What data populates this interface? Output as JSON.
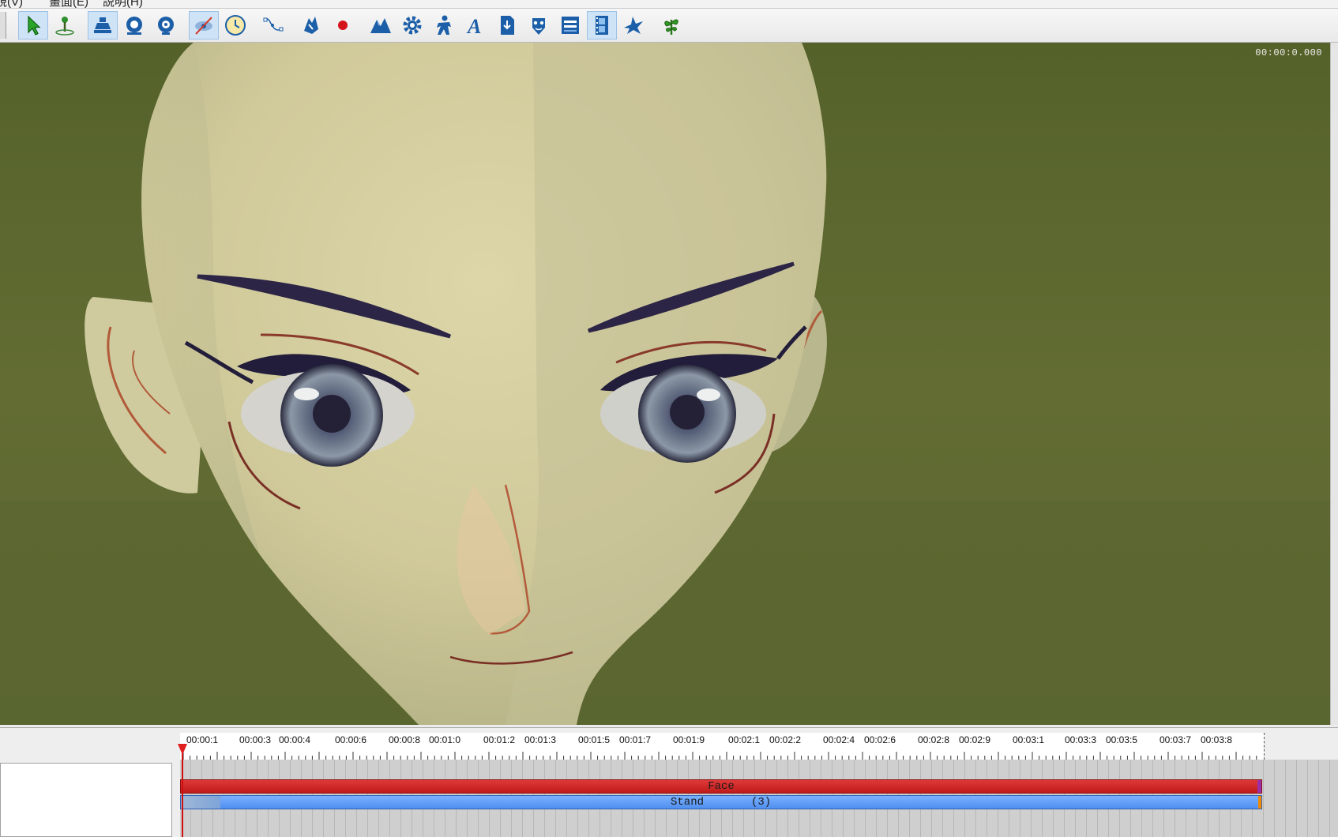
{
  "menubar": {
    "items": [
      "視(V)",
      "畫面(E)",
      "説明(H)"
    ]
  },
  "toolbar": {
    "buttons": [
      {
        "icon": "select-arrow-icon",
        "active": true
      },
      {
        "icon": "move-pin-icon",
        "active": false
      },
      {
        "icon": "camera-stage-icon",
        "active": true
      },
      {
        "icon": "orbit-icon",
        "active": false
      },
      {
        "icon": "zoom-circle-icon",
        "active": false
      },
      {
        "icon": "hidden-eye-icon",
        "active": true
      },
      {
        "icon": "clock-icon",
        "active": false
      },
      {
        "icon": "curve-path-icon",
        "active": false
      },
      {
        "icon": "hand-icon",
        "active": false
      },
      {
        "icon": "record-icon",
        "active": false
      },
      {
        "icon": "terrain-icon",
        "active": false
      },
      {
        "icon": "gear-icon",
        "active": false
      },
      {
        "icon": "character-icon",
        "active": false
      },
      {
        "icon": "text-icon",
        "active": false
      },
      {
        "icon": "import-icon",
        "active": false
      },
      {
        "icon": "face-icon",
        "active": false
      },
      {
        "icon": "panel-icon",
        "active": false
      },
      {
        "icon": "film-icon",
        "active": true
      },
      {
        "icon": "bird-icon",
        "active": false
      },
      {
        "icon": "plant-icon",
        "active": false
      }
    ]
  },
  "viewport": {
    "timecode": "00:00:0.000"
  },
  "timeline": {
    "ruler_labels": [
      "00:00:1",
      "00:00:3",
      "00:00:4",
      "00:00:6",
      "00:00:8",
      "00:01:0",
      "00:01:2",
      "00:01:3",
      "00:01:5",
      "00:01:7",
      "00:01:9",
      "00:02:1",
      "00:02:2",
      "00:02:4",
      "00:02:6",
      "00:02:8",
      "00:02:9",
      "00:03:1",
      "00:03:3",
      "00:03:5",
      "00:03:7",
      "00:03:8"
    ],
    "tracks": {
      "face": {
        "label": "Face"
      },
      "stand": {
        "label": "Stand",
        "count": "(3)"
      }
    }
  },
  "colors": {
    "face_track": "#d02828",
    "stand_track": "#5b9bf5",
    "playhead": "#e02020",
    "grass": "#5e6a2d"
  }
}
